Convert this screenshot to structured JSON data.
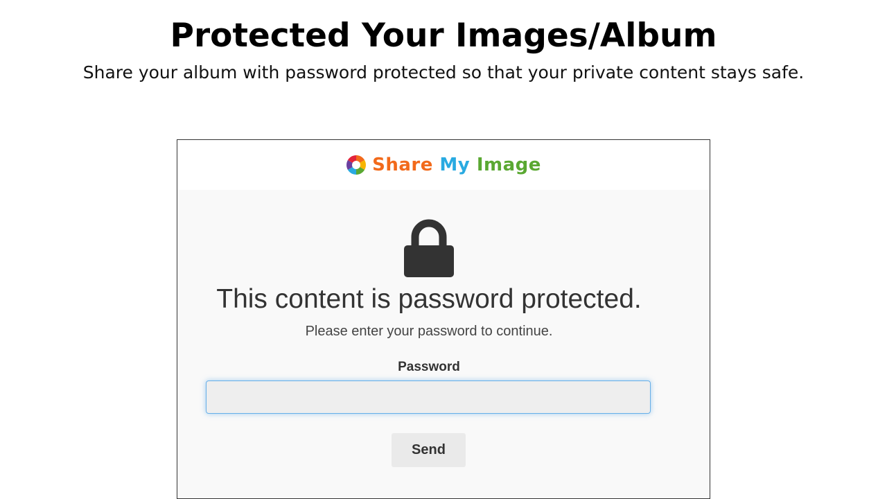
{
  "promo": {
    "title": "Protected Your Images/Album",
    "subtitle": "Share your album with password protected so that your private content stays safe."
  },
  "brand": {
    "word1": "Share",
    "word2": "My",
    "word3": "Image",
    "logo_icon": "aperture-logo-icon",
    "colors": {
      "word1": "#f26a1b",
      "word2": "#29aae1",
      "word3": "#5aa832"
    }
  },
  "protected_page": {
    "lock_icon": "lock-icon",
    "heading": "This content is password protected.",
    "instructions": "Please enter your password to continue.",
    "password_label": "Password",
    "password_value": "",
    "send_label": "Send"
  }
}
